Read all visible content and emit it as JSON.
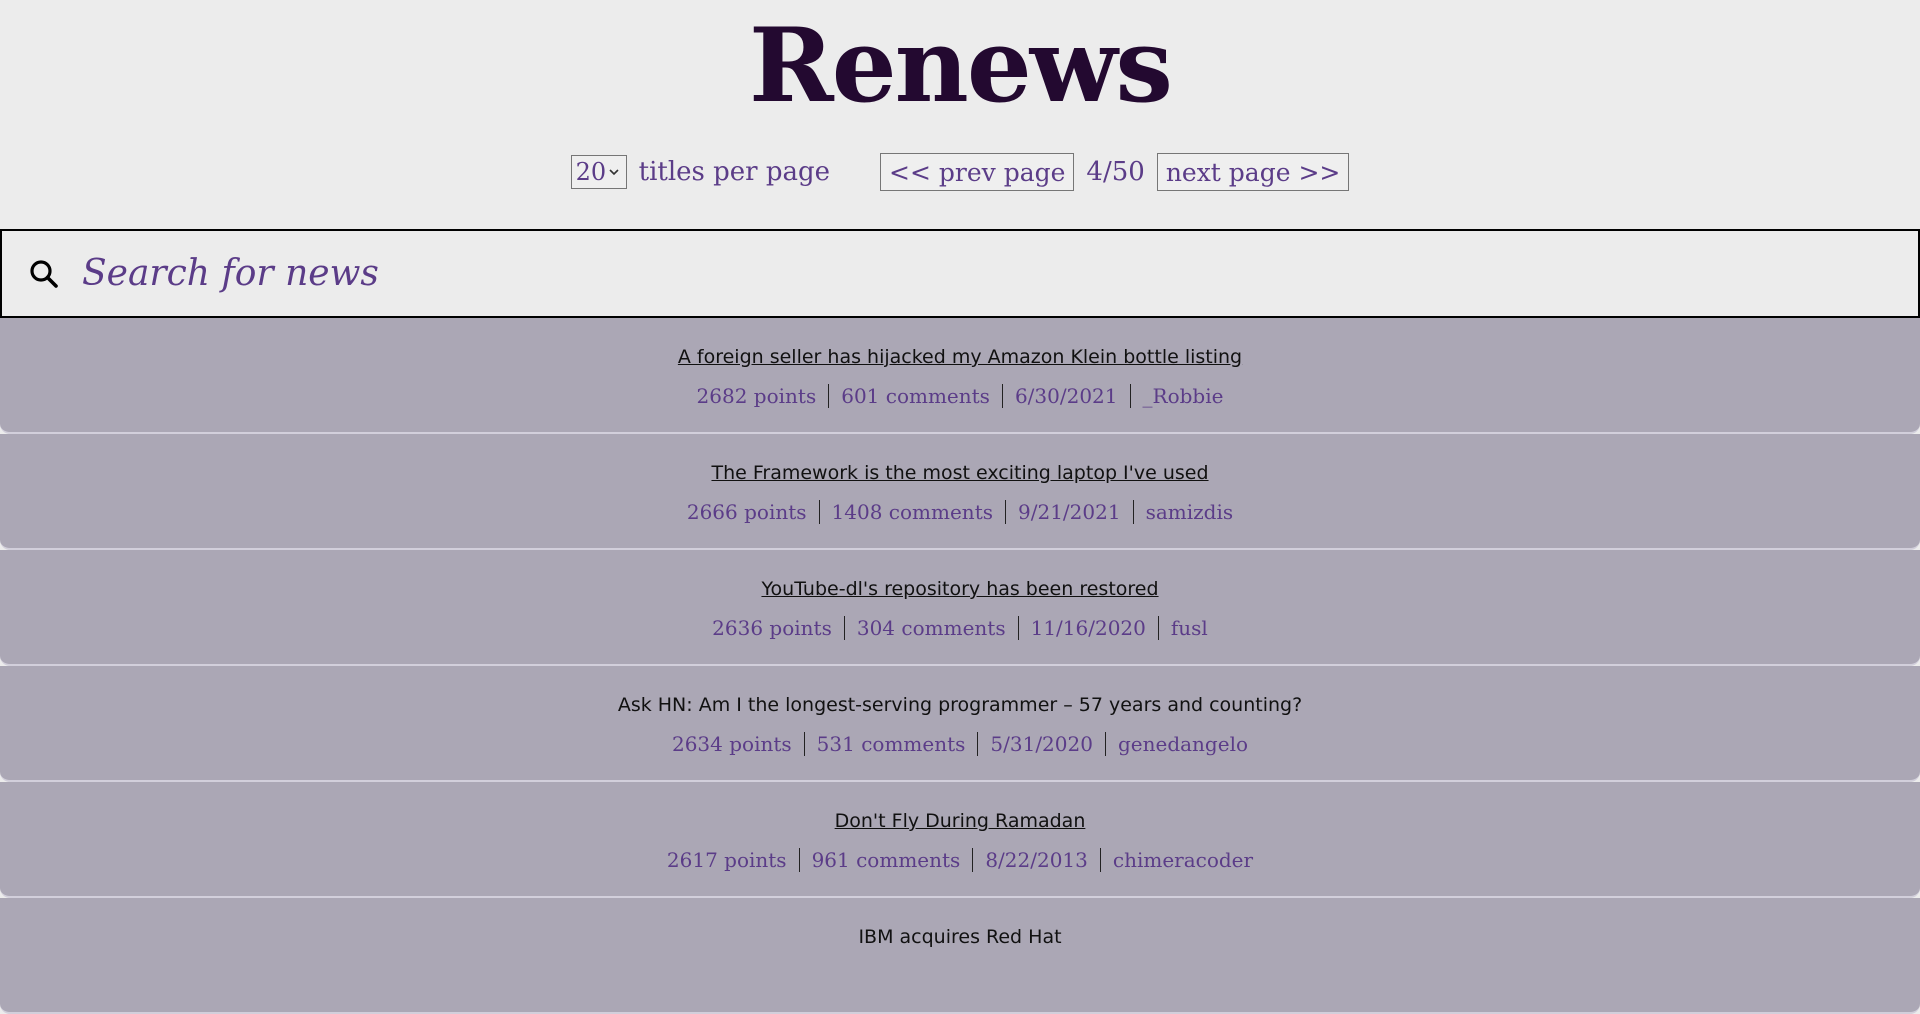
{
  "header": {
    "title": "Renews"
  },
  "controls": {
    "per_page_value": "20",
    "per_page_label": "titles per page",
    "prev_label": "<< prev page",
    "page_indicator": "4/50",
    "next_label": "next page >>"
  },
  "search": {
    "placeholder": "Search for news",
    "icon": "search-icon"
  },
  "items": [
    {
      "title": "A foreign seller has hijacked my Amazon Klein bottle listing",
      "link": true,
      "points": "2682 points",
      "comments": "601 comments",
      "date": "6/30/2021",
      "author": "_Robbie"
    },
    {
      "title": "The Framework is the most exciting laptop I've used",
      "link": true,
      "points": "2666 points",
      "comments": "1408 comments",
      "date": "9/21/2021",
      "author": "samizdis"
    },
    {
      "title": "YouTube-dl's repository has been restored",
      "link": true,
      "points": "2636 points",
      "comments": "304 comments",
      "date": "11/16/2020",
      "author": "fusl"
    },
    {
      "title": "Ask HN: Am I the longest-serving programmer – 57 years and counting?",
      "link": false,
      "points": "2634 points",
      "comments": "531 comments",
      "date": "5/31/2020",
      "author": "genedangelo"
    },
    {
      "title": "Don't Fly During Ramadan",
      "link": true,
      "points": "2617 points",
      "comments": "961 comments",
      "date": "8/22/2013",
      "author": "chimeracoder"
    },
    {
      "title": "IBM acquires Red Hat",
      "link": false,
      "points": "",
      "comments": "",
      "date": "",
      "author": ""
    }
  ],
  "colors": {
    "background": "#ececec",
    "title": "#230930",
    "accent": "#5b3c88",
    "item_bg": "#aba7b5"
  }
}
